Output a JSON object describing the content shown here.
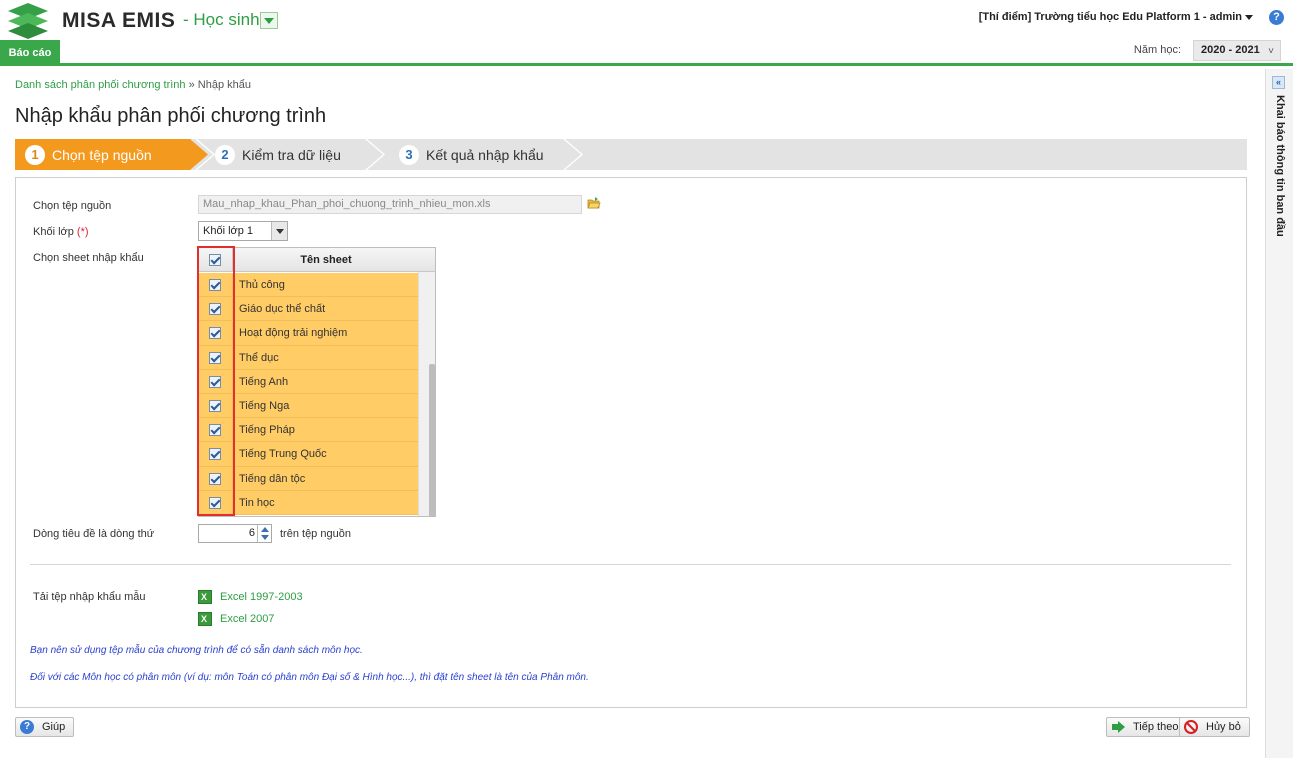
{
  "header": {
    "logo_text": "MISA EMIS",
    "module": "- Học sinh",
    "school_user": "[Thí điểm] Trường tiểu học Edu Platform 1 - admin",
    "report_tab": "Báo cáo",
    "year_label": "Năm học:",
    "year_value": "2020 - 2021"
  },
  "side_panel": {
    "label": "Khai báo thông tin ban đầu"
  },
  "breadcrumb": {
    "parent": "Danh sách phân phối chương trình",
    "separator": "»",
    "current": "Nhập khẩu"
  },
  "page_title": "Nhập khẩu phân phối chương trình",
  "wizard": {
    "steps": [
      {
        "num": "1",
        "label": "Chọn tệp nguồn",
        "active": true
      },
      {
        "num": "2",
        "label": "Kiểm tra dữ liệu",
        "active": false
      },
      {
        "num": "3",
        "label": "Kết quả nhập khẩu",
        "active": false
      }
    ]
  },
  "form": {
    "source_file_label": "Chọn tệp nguồn",
    "source_file_value": "Mau_nhap_khau_Phan_phoi_chuong_trinh_nhieu_mon.xls",
    "grade_label": "Khối lớp",
    "required_mark": "(*)",
    "grade_value": "Khối lớp 1",
    "sheet_label": "Chọn sheet nhập khẩu",
    "sheet_header": "Tên sheet",
    "sheets": [
      {
        "name": "Thủ công",
        "checked": true
      },
      {
        "name": "Giáo dục thể chất",
        "checked": true
      },
      {
        "name": "Hoạt động trải nghiệm",
        "checked": true
      },
      {
        "name": "Thể dục",
        "checked": true
      },
      {
        "name": "Tiếng Anh",
        "checked": true
      },
      {
        "name": "Tiếng Nga",
        "checked": true
      },
      {
        "name": "Tiếng Pháp",
        "checked": true
      },
      {
        "name": "Tiếng Trung Quốc",
        "checked": true
      },
      {
        "name": "Tiếng dân tộc",
        "checked": true
      },
      {
        "name": "Tin học",
        "checked": true
      }
    ],
    "header_row_label": "Dòng tiêu đề là dòng thứ",
    "header_row_value": "6",
    "header_row_suffix": "trên tệp nguồn",
    "template_label": "Tải tệp nhập khẩu mẫu",
    "template_links": [
      "Excel 1997-2003",
      "Excel 2007"
    ],
    "note_1": "Bạn nên sử dụng tệp mẫu của chương trình để có sẵn danh sách môn học.",
    "note_2": "Đối với các Môn học có phân môn (ví dụ: môn Toán có phân môn Đại số & Hình học...), thì đặt tên sheet là tên của Phân môn."
  },
  "footer": {
    "help": "Giúp",
    "next": "Tiếp theo",
    "cancel": "Hủy bỏ"
  },
  "colors": {
    "brand_green": "#3aa84a",
    "active_step": "#f39a1e",
    "selected_row": "#ffcc66",
    "highlight_border": "#e02f2f",
    "note_text": "#2a3fcf"
  }
}
